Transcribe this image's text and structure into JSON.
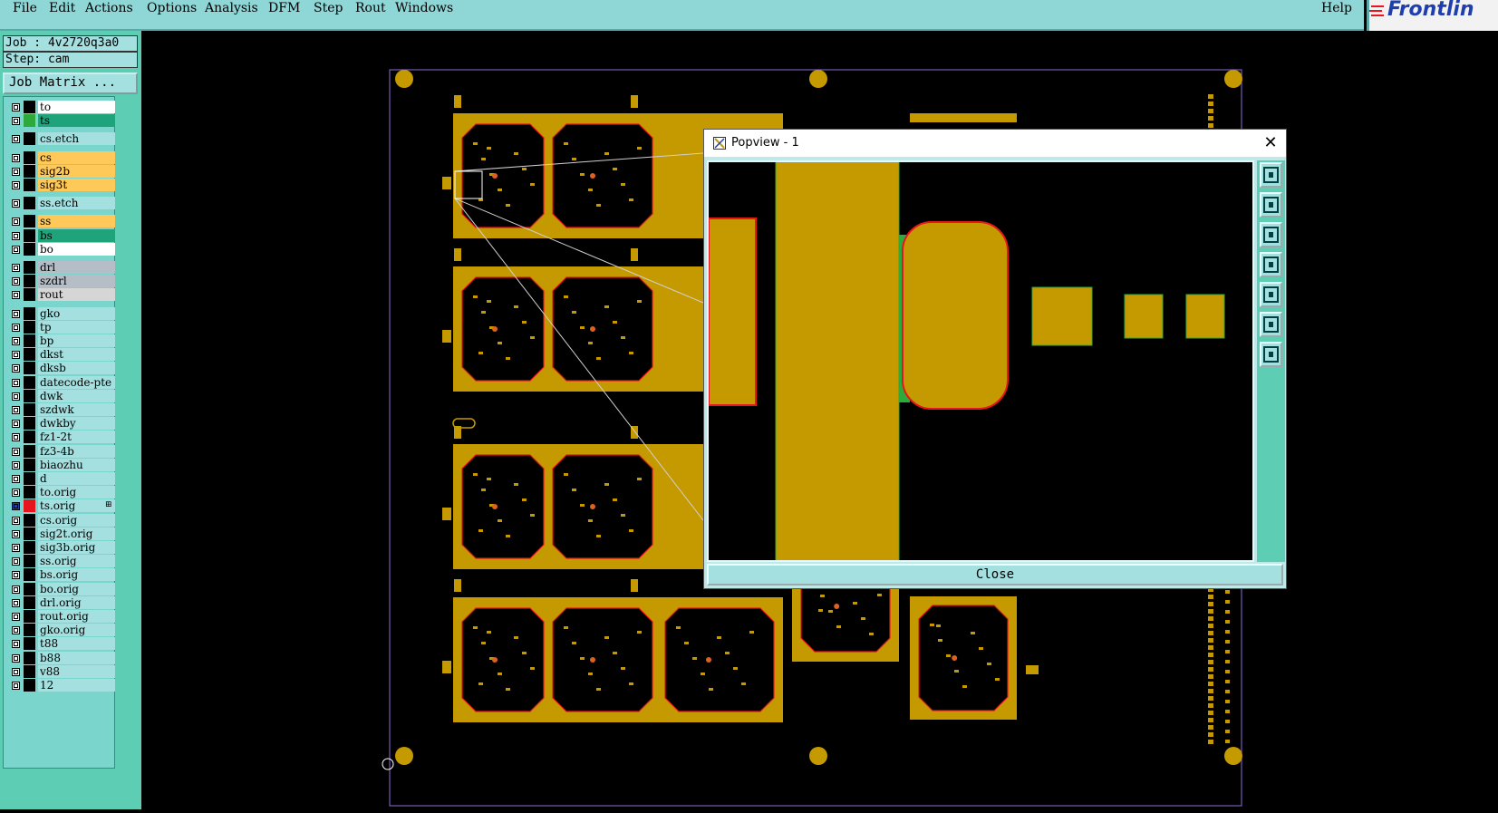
{
  "menu": {
    "items": [
      {
        "label": "File"
      },
      {
        "label": "Edit"
      },
      {
        "label": "Actions"
      },
      {
        "label": "Options"
      },
      {
        "label": "Analysis"
      },
      {
        "label": "DFM"
      },
      {
        "label": "Step"
      },
      {
        "label": "Rout"
      },
      {
        "label": "Windows"
      }
    ],
    "help": "Help",
    "brand": "Frontlin"
  },
  "job": {
    "job_line": "Job : 4v2720q3a0",
    "step_line": "Step: cam",
    "matrix_button": "Job Matrix ..."
  },
  "layers": [
    {
      "name": "to",
      "color": "#ffffff",
      "swatch": "#000000"
    },
    {
      "name": "ts",
      "color": "#1fa37a",
      "swatch": "#2eaa3a"
    },
    {
      "name": "cs.etch",
      "color": "#a4e0e0",
      "swatch": "#000000"
    },
    {
      "name": "cs",
      "color": "#ffc95a",
      "swatch": "#000000"
    },
    {
      "name": "sig2b",
      "color": "#ffc95a",
      "swatch": "#000000"
    },
    {
      "name": "sig3t",
      "color": "#ffc95a",
      "swatch": "#000000"
    },
    {
      "name": "ss.etch",
      "color": "#a4e0e0",
      "swatch": "#000000"
    },
    {
      "name": "ss",
      "color": "#ffc95a",
      "swatch": "#000000"
    },
    {
      "name": "bs",
      "color": "#1fa37a",
      "swatch": "#000000"
    },
    {
      "name": "bo",
      "color": "#ffffff",
      "swatch": "#000000"
    },
    {
      "name": "drl",
      "color": "#b5bec6",
      "swatch": "#000000"
    },
    {
      "name": "szdrl",
      "color": "#b5bec6",
      "swatch": "#000000"
    },
    {
      "name": "rout",
      "color": "#d6d6d6",
      "swatch": "#000000"
    },
    {
      "name": "gko",
      "color": "#a4e0e0",
      "swatch": "#000000"
    },
    {
      "name": "tp",
      "color": "#a4e0e0",
      "swatch": "#000000"
    },
    {
      "name": "bp",
      "color": "#a4e0e0",
      "swatch": "#000000"
    },
    {
      "name": "dkst",
      "color": "#a4e0e0",
      "swatch": "#000000"
    },
    {
      "name": "dksb",
      "color": "#a4e0e0",
      "swatch": "#000000"
    },
    {
      "name": "datecode-pte",
      "color": "#a4e0e0",
      "swatch": "#000000"
    },
    {
      "name": "dwk",
      "color": "#a4e0e0",
      "swatch": "#000000"
    },
    {
      "name": "szdwk",
      "color": "#a4e0e0",
      "swatch": "#000000"
    },
    {
      "name": "dwkby",
      "color": "#a4e0e0",
      "swatch": "#000000"
    },
    {
      "name": "fz1-2t",
      "color": "#a4e0e0",
      "swatch": "#000000"
    },
    {
      "name": "fz3-4b",
      "color": "#a4e0e0",
      "swatch": "#000000"
    },
    {
      "name": "biaozhu",
      "color": "#a4e0e0",
      "swatch": "#000000"
    },
    {
      "name": "d",
      "color": "#a4e0e0",
      "swatch": "#000000"
    },
    {
      "name": "to.orig",
      "color": "#a4e0e0",
      "swatch": "#000000"
    },
    {
      "name": "ts.orig",
      "color": "#a4e0e0",
      "swatch": "#e8141e",
      "active": true
    },
    {
      "name": "cs.orig",
      "color": "#a4e0e0",
      "swatch": "#000000"
    },
    {
      "name": "sig2t.orig",
      "color": "#a4e0e0",
      "swatch": "#000000"
    },
    {
      "name": "sig3b.orig",
      "color": "#a4e0e0",
      "swatch": "#000000"
    },
    {
      "name": "ss.orig",
      "color": "#a4e0e0",
      "swatch": "#000000"
    },
    {
      "name": "bs.orig",
      "color": "#a4e0e0",
      "swatch": "#000000"
    },
    {
      "name": "bo.orig",
      "color": "#a4e0e0",
      "swatch": "#000000"
    },
    {
      "name": "drl.orig",
      "color": "#a4e0e0",
      "swatch": "#000000"
    },
    {
      "name": "rout.orig",
      "color": "#a4e0e0",
      "swatch": "#000000"
    },
    {
      "name": "gko.orig",
      "color": "#a4e0e0",
      "swatch": "#000000"
    },
    {
      "name": "t88",
      "color": "#a4e0e0",
      "swatch": "#000000"
    },
    {
      "name": "b88",
      "color": "#a4e0e0",
      "swatch": "#000000"
    },
    {
      "name": "v88",
      "color": "#a4e0e0",
      "swatch": "#000000"
    },
    {
      "name": "12",
      "color": "#a4e0e0",
      "swatch": "#000000"
    }
  ],
  "popview": {
    "title": "Popview - 1",
    "close_label": "Close",
    "tools": [
      "zoom-window-icon",
      "pan-up-icon",
      "pan-down-icon",
      "pan-left-icon",
      "pan-right-icon",
      "zoom-fit-icon",
      "zoom-home-icon"
    ]
  },
  "colors": {
    "copper": "#c59a00",
    "outline_red": "#e8141e",
    "panel": "#5dcdb4",
    "menubar": "#8fd6d6"
  }
}
